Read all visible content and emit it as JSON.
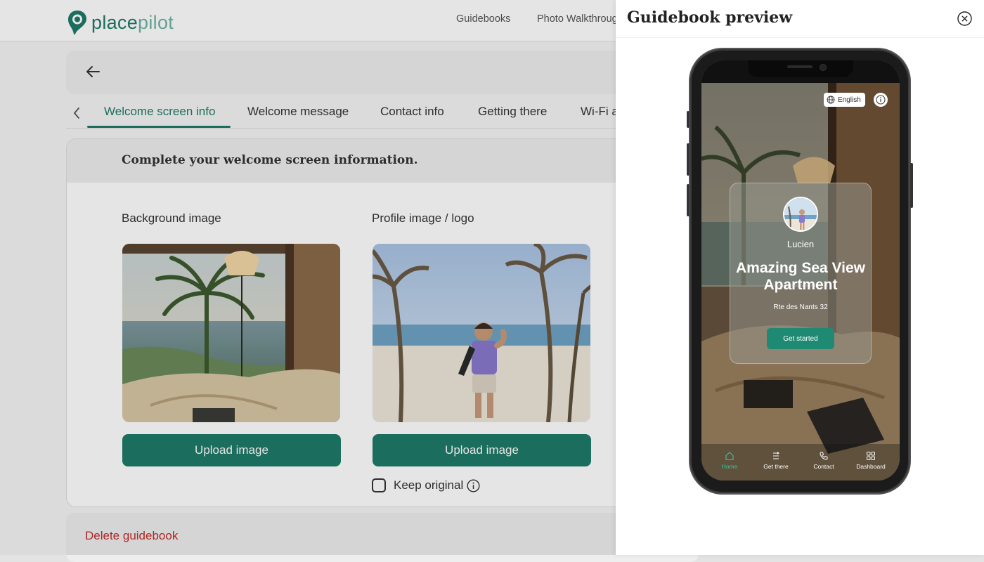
{
  "brand": {
    "logo_text_bold": "place",
    "logo_text_light": "pilot",
    "accent": "#1f7a68"
  },
  "topnav": {
    "items": [
      "Guidebooks",
      "Photo Walkthrough"
    ]
  },
  "tabs": {
    "items": [
      "Welcome screen info",
      "Welcome message",
      "Contact info",
      "Getting there",
      "Wi-Fi a"
    ],
    "active_index": 0
  },
  "card": {
    "heading": "Complete your welcome screen information.",
    "background_label": "Background image",
    "profile_label": "Profile image / logo",
    "upload_label_1": "Upload image",
    "upload_label_2": "Upload image",
    "keep_original_label": "Keep original",
    "keep_original_checked": false
  },
  "danger": {
    "delete_label": "Delete guidebook",
    "color": "#c42a2a"
  },
  "drawer": {
    "title": "Guidebook preview"
  },
  "preview": {
    "language": "English",
    "host_name": "Lucien",
    "property_title": "Amazing Sea View Apartment",
    "address": "Rte des Nants 32",
    "cta_label": "Get started",
    "nav": [
      {
        "label": "Home",
        "icon": "home-icon",
        "active": true
      },
      {
        "label": "Get there",
        "icon": "directions-icon",
        "active": false
      },
      {
        "label": "Contact",
        "icon": "phone-icon",
        "active": false
      },
      {
        "label": "Dashboard",
        "icon": "grid-icon",
        "active": false
      }
    ]
  }
}
